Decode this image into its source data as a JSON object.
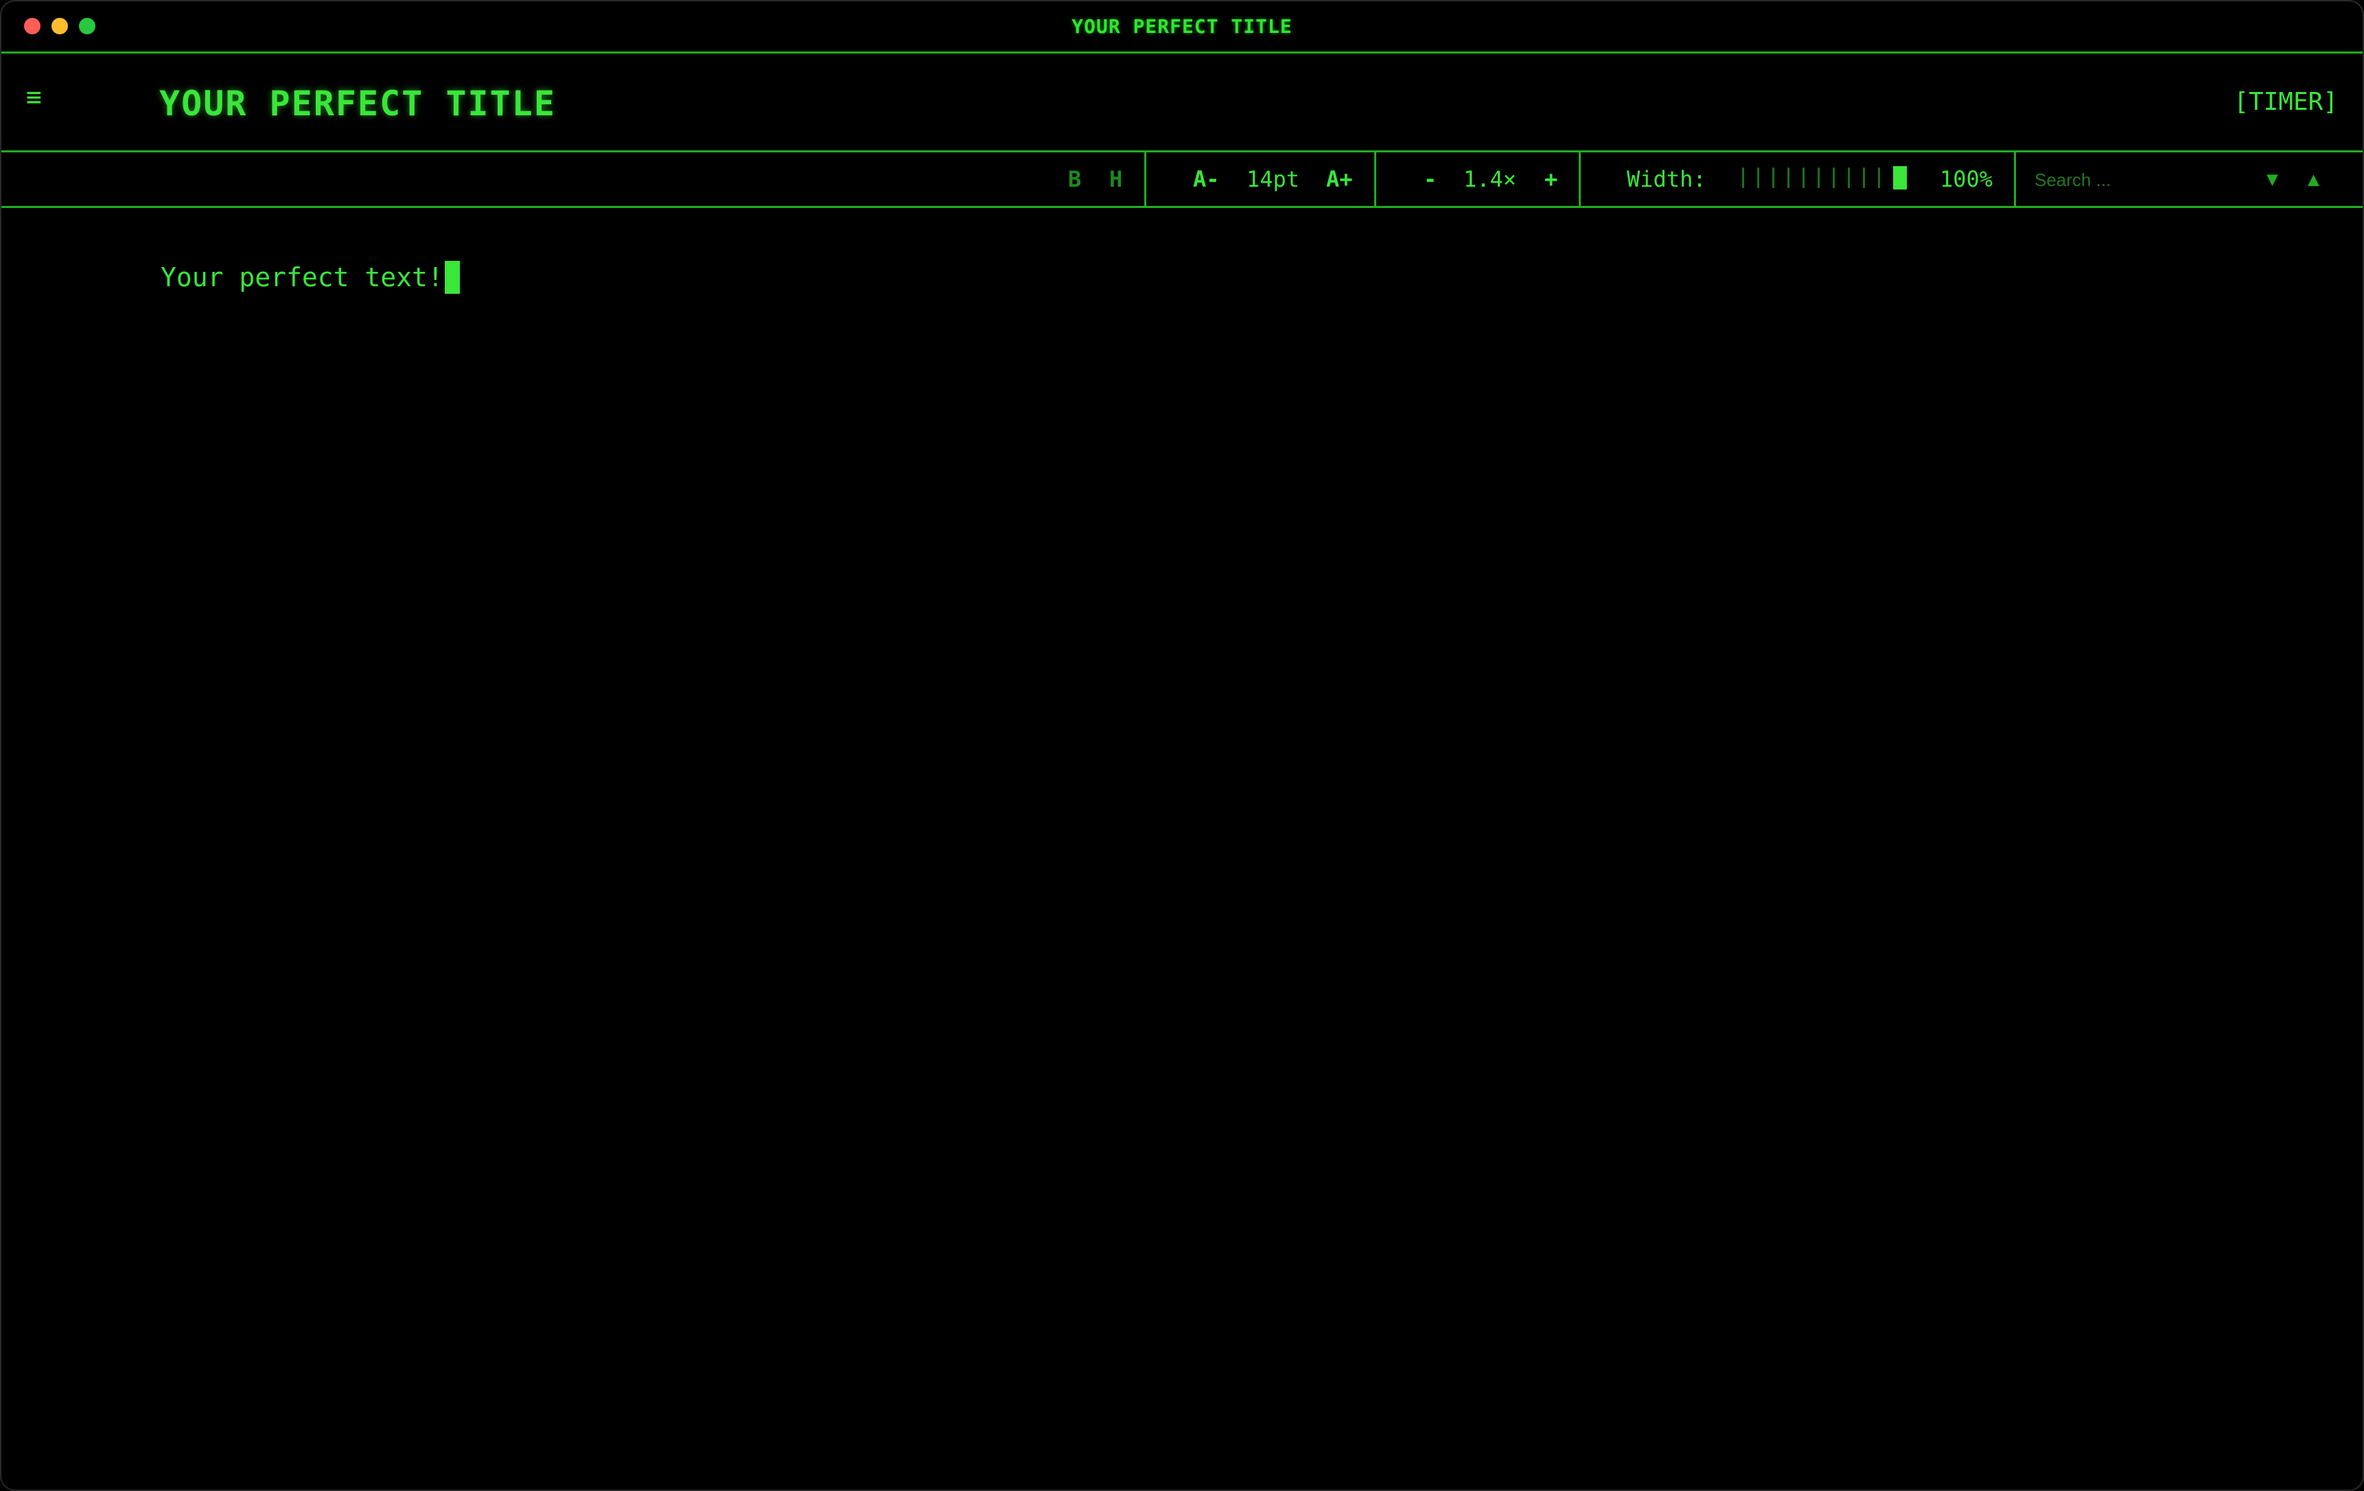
{
  "window": {
    "title": "YOUR PERFECT TITLE"
  },
  "header": {
    "menu_icon": "≡",
    "title": "YOUR PERFECT TITLE",
    "timer": "[TIMER]"
  },
  "toolbar": {
    "bold": "B",
    "heading": "H",
    "font_decrease": "A-",
    "font_size": "14pt",
    "font_increase": "A+",
    "line_height_decrease": "-",
    "line_height": "1.4×",
    "line_height_increase": "+",
    "width_label": "Width:",
    "width_value": "100%",
    "width_fraction": 1.0,
    "search_placeholder": "Search ...",
    "search_value": "",
    "next_icon": "▼",
    "prev_icon": "▲"
  },
  "editor": {
    "text": "Your perfect text!"
  },
  "colors": {
    "accent": "#39e639",
    "border": "#1fae1f",
    "background": "#000000"
  }
}
